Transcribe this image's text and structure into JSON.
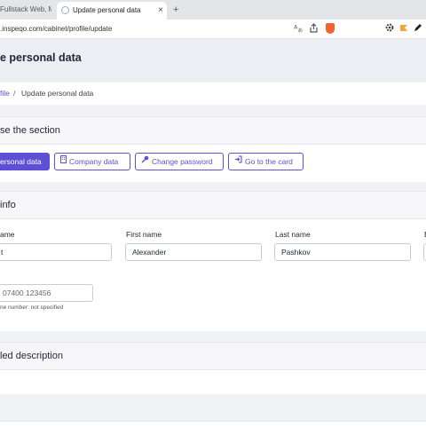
{
  "browser": {
    "tabs": [
      {
        "title": "Fullstack Web, Mob"
      },
      {
        "title": "Update personal data"
      }
    ],
    "new_tab_symbol": "+",
    "close_symbol": "×",
    "url": ".inspeqo.com/cabinet/profile/update",
    "icons": [
      "translate-icon",
      "share-icon",
      "brave-shield-icon",
      "settings-icon",
      "extension-icon",
      "pen-icon"
    ]
  },
  "page": {
    "title": "e personal data",
    "breadcrumb": {
      "link": "file",
      "separator": "/",
      "current": "Update personal data"
    }
  },
  "section_chooser": {
    "heading": "se the section",
    "buttons": [
      {
        "label": "ersonal data",
        "icon": "user-icon",
        "active": true
      },
      {
        "label": "Company data",
        "icon": "building-icon",
        "active": false
      },
      {
        "label": "Change password",
        "icon": "key-icon",
        "active": false
      },
      {
        "label": "Go to the card",
        "icon": "sign-in-icon",
        "active": false
      }
    ]
  },
  "info": {
    "heading": " info",
    "fields": [
      {
        "label": "ame",
        "value": "t"
      },
      {
        "label": "First name",
        "value": "Alexander"
      },
      {
        "label": "Last name",
        "value": "Pashkov"
      }
    ],
    "phone": {
      "placeholder": "07400 123456",
      "hint": "ne number: not specified"
    }
  },
  "description": {
    "heading": "led description"
  },
  "colors": {
    "accent": "#5b50d6",
    "page_bg": "#f1f2f6",
    "header_bg": "#eceef4"
  }
}
